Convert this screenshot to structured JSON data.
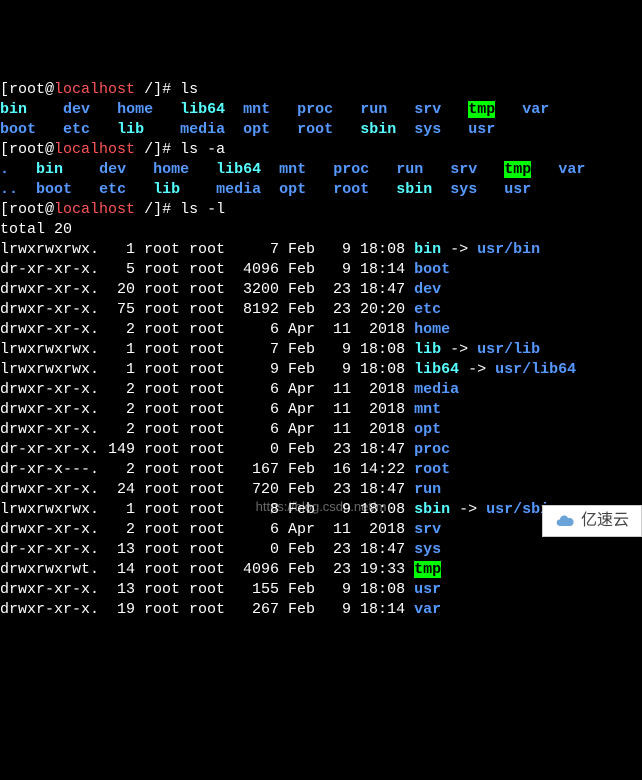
{
  "prompt": {
    "brk_open": "[",
    "user": "root",
    "at": "@",
    "host": "localhost",
    "path": " /]# "
  },
  "cmd_ls": "ls",
  "cmd_ls_a": "ls -a",
  "cmd_ls_l": "ls -l",
  "row1": {
    "bin": "bin",
    "dev": "dev",
    "home": "home",
    "lib64": "lib64",
    "mnt": "mnt",
    "proc": "proc",
    "run": "run",
    "srv": "srv",
    "tmp": "tmp",
    "var": "var"
  },
  "row2": {
    "boot": "boot",
    "etc": "etc",
    "lib": "lib",
    "media": "media",
    "opt": "opt",
    "root": "root",
    "sbin": "sbin",
    "sys": "sys",
    "usr": "usr"
  },
  "dots": {
    "dot": ".",
    "dotdot": ".."
  },
  "total_line": "total 20",
  "arrow": " -> ",
  "listing": [
    {
      "perm": "lrwxrwxrwx.",
      "nl": "  1",
      "o": "root",
      "g": "root",
      "sz": "    7",
      "dt": "Feb   9 18:08",
      "name": "bin",
      "link": "usr/bin",
      "color": "cyan",
      "linkcolor": "blue"
    },
    {
      "perm": "dr-xr-xr-x.",
      "nl": "  5",
      "o": "root",
      "g": "root",
      "sz": " 4096",
      "dt": "Feb   9 18:14",
      "name": "boot",
      "color": "blue"
    },
    {
      "perm": "drwxr-xr-x.",
      "nl": " 20",
      "o": "root",
      "g": "root",
      "sz": " 3200",
      "dt": "Feb  23 18:47",
      "name": "dev",
      "color": "blue"
    },
    {
      "perm": "drwxr-xr-x.",
      "nl": " 75",
      "o": "root",
      "g": "root",
      "sz": " 8192",
      "dt": "Feb  23 20:20",
      "name": "etc",
      "color": "blue"
    },
    {
      "perm": "drwxr-xr-x.",
      "nl": "  2",
      "o": "root",
      "g": "root",
      "sz": "    6",
      "dt": "Apr  11  2018",
      "name": "home",
      "color": "blue"
    },
    {
      "perm": "lrwxrwxrwx.",
      "nl": "  1",
      "o": "root",
      "g": "root",
      "sz": "    7",
      "dt": "Feb   9 18:08",
      "name": "lib",
      "link": "usr/lib",
      "color": "cyan",
      "linkcolor": "blue"
    },
    {
      "perm": "lrwxrwxrwx.",
      "nl": "  1",
      "o": "root",
      "g": "root",
      "sz": "    9",
      "dt": "Feb   9 18:08",
      "name": "lib64",
      "link": "usr/lib64",
      "color": "cyan",
      "linkcolor": "blue"
    },
    {
      "perm": "drwxr-xr-x.",
      "nl": "  2",
      "o": "root",
      "g": "root",
      "sz": "    6",
      "dt": "Apr  11  2018",
      "name": "media",
      "color": "blue"
    },
    {
      "perm": "drwxr-xr-x.",
      "nl": "  2",
      "o": "root",
      "g": "root",
      "sz": "    6",
      "dt": "Apr  11  2018",
      "name": "mnt",
      "color": "blue"
    },
    {
      "perm": "drwxr-xr-x.",
      "nl": "  2",
      "o": "root",
      "g": "root",
      "sz": "    6",
      "dt": "Apr  11  2018",
      "name": "opt",
      "color": "blue"
    },
    {
      "perm": "dr-xr-xr-x.",
      "nl": "149",
      "o": "root",
      "g": "root",
      "sz": "    0",
      "dt": "Feb  23 18:47",
      "name": "proc",
      "color": "blue"
    },
    {
      "perm": "dr-xr-x---.",
      "nl": "  2",
      "o": "root",
      "g": "root",
      "sz": "  167",
      "dt": "Feb  16 14:22",
      "name": "root",
      "color": "blue"
    },
    {
      "perm": "drwxr-xr-x.",
      "nl": " 24",
      "o": "root",
      "g": "root",
      "sz": "  720",
      "dt": "Feb  23 18:47",
      "name": "run",
      "color": "blue"
    },
    {
      "perm": "lrwxrwxrwx.",
      "nl": "  1",
      "o": "root",
      "g": "root",
      "sz": "    8",
      "dt": "Feb   9 18:08",
      "name": "sbin",
      "link": "usr/sbin",
      "color": "cyan",
      "linkcolor": "blue"
    },
    {
      "perm": "drwxr-xr-x.",
      "nl": "  2",
      "o": "root",
      "g": "root",
      "sz": "    6",
      "dt": "Apr  11  2018",
      "name": "srv",
      "color": "blue"
    },
    {
      "perm": "dr-xr-xr-x.",
      "nl": " 13",
      "o": "root",
      "g": "root",
      "sz": "    0",
      "dt": "Feb  23 18:47",
      "name": "sys",
      "color": "blue"
    },
    {
      "perm": "drwxrwxrwt.",
      "nl": " 14",
      "o": "root",
      "g": "root",
      "sz": " 4096",
      "dt": "Feb  23 19:33",
      "name": "tmp",
      "color": "greenbg"
    },
    {
      "perm": "drwxr-xr-x.",
      "nl": " 13",
      "o": "root",
      "g": "root",
      "sz": "  155",
      "dt": "Feb   9 18:08",
      "name": "usr",
      "color": "blue"
    },
    {
      "perm": "drwxr-xr-x.",
      "nl": " 19",
      "o": "root",
      "g": "root",
      "sz": "  267",
      "dt": "Feb   9 18:14",
      "name": "var",
      "color": "blue"
    }
  ],
  "watermark": "https://blog.csdn.net/m",
  "brand_text": "亿速云"
}
